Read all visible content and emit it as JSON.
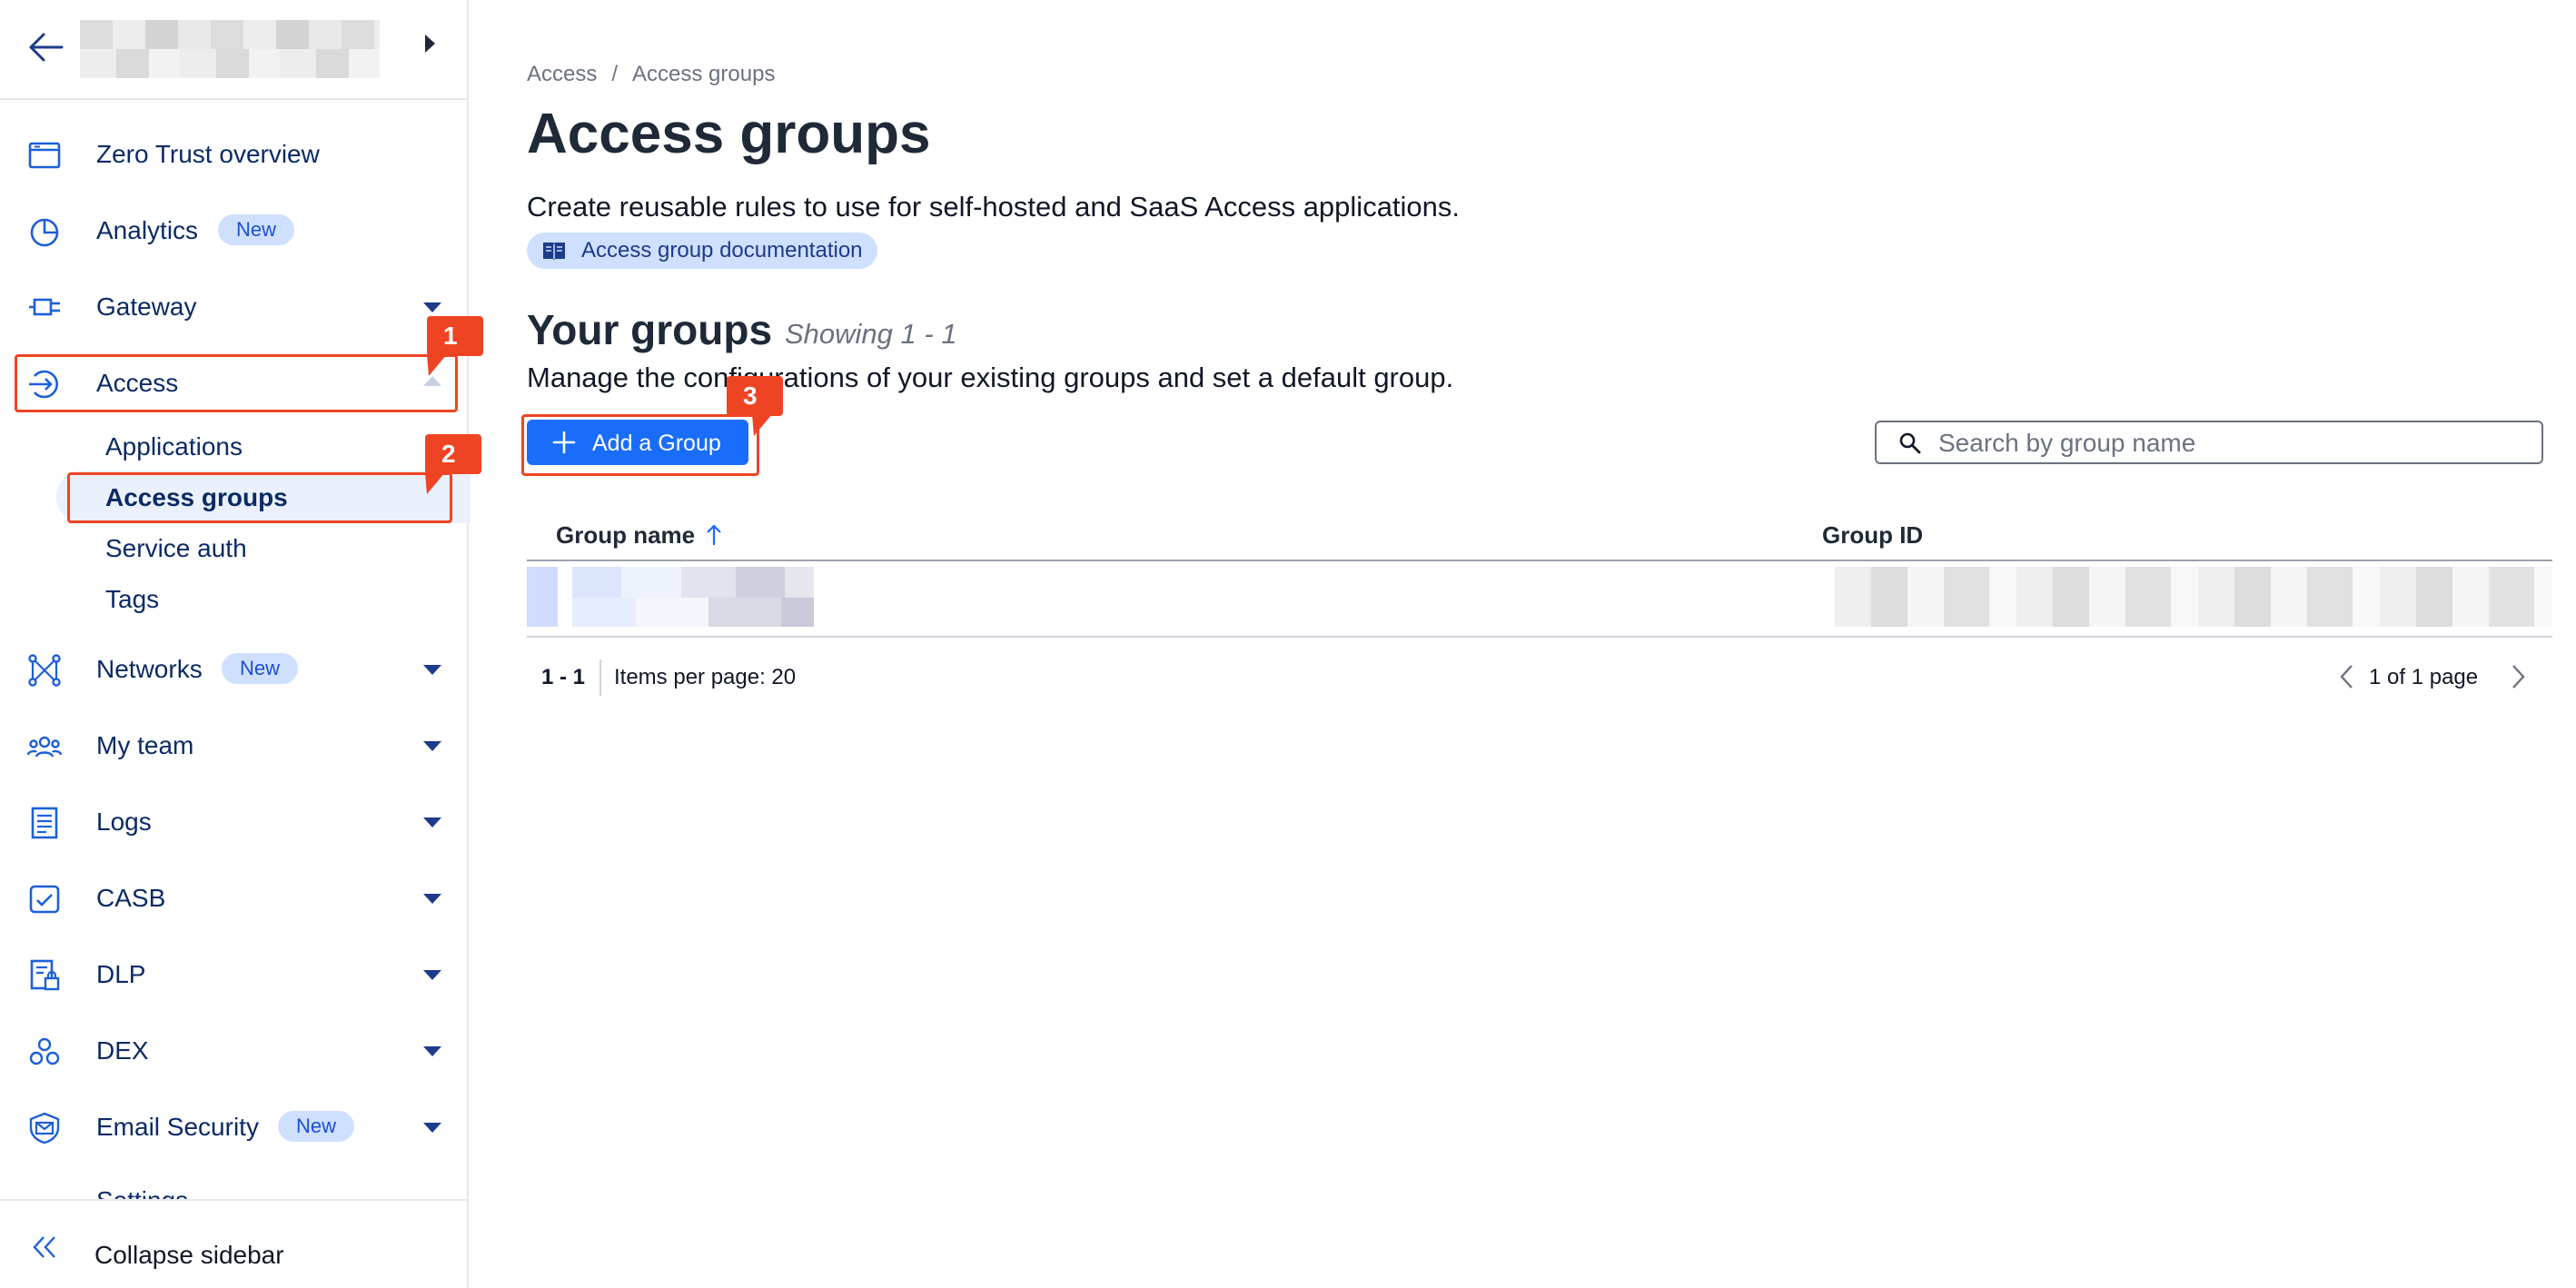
{
  "sidebar": {
    "items": [
      {
        "label": "Zero Trust overview"
      },
      {
        "label": "Analytics",
        "badge": "New"
      },
      {
        "label": "Gateway"
      },
      {
        "label": "Access"
      },
      {
        "label": "Networks",
        "badge": "New"
      },
      {
        "label": "My team"
      },
      {
        "label": "Logs"
      },
      {
        "label": "CASB"
      },
      {
        "label": "DLP"
      },
      {
        "label": "DEX"
      },
      {
        "label": "Email Security",
        "badge": "New"
      }
    ],
    "access_sub": [
      "Applications",
      "Access groups",
      "Service auth",
      "Tags"
    ],
    "settings_peek": "Settings",
    "collapse_label": "Collapse sidebar"
  },
  "annotations": [
    "1",
    "2",
    "3"
  ],
  "main": {
    "breadcrumb": [
      "Access",
      "/",
      "Access groups"
    ],
    "title": "Access groups",
    "description": "Create reusable rules to use for self-hosted and SaaS Access applications.",
    "doc_link": "Access group documentation",
    "section_title": "Your groups",
    "section_count": "Showing 1 - 1",
    "section_desc": "Manage the configurations of your existing groups and set a default group.",
    "add_button": "Add a Group",
    "search_placeholder": "Search by group name",
    "columns": [
      "Group name",
      "Group ID"
    ],
    "pagination": {
      "range": "1 - 1",
      "per_page": "Items per page: 20",
      "page_info": "1 of 1 page"
    }
  },
  "colors": {
    "accent": "#1a6dfa",
    "annotation": "#ef4423",
    "nav_text": "#0b2a66",
    "badge_bg": "#cfe0ff"
  }
}
